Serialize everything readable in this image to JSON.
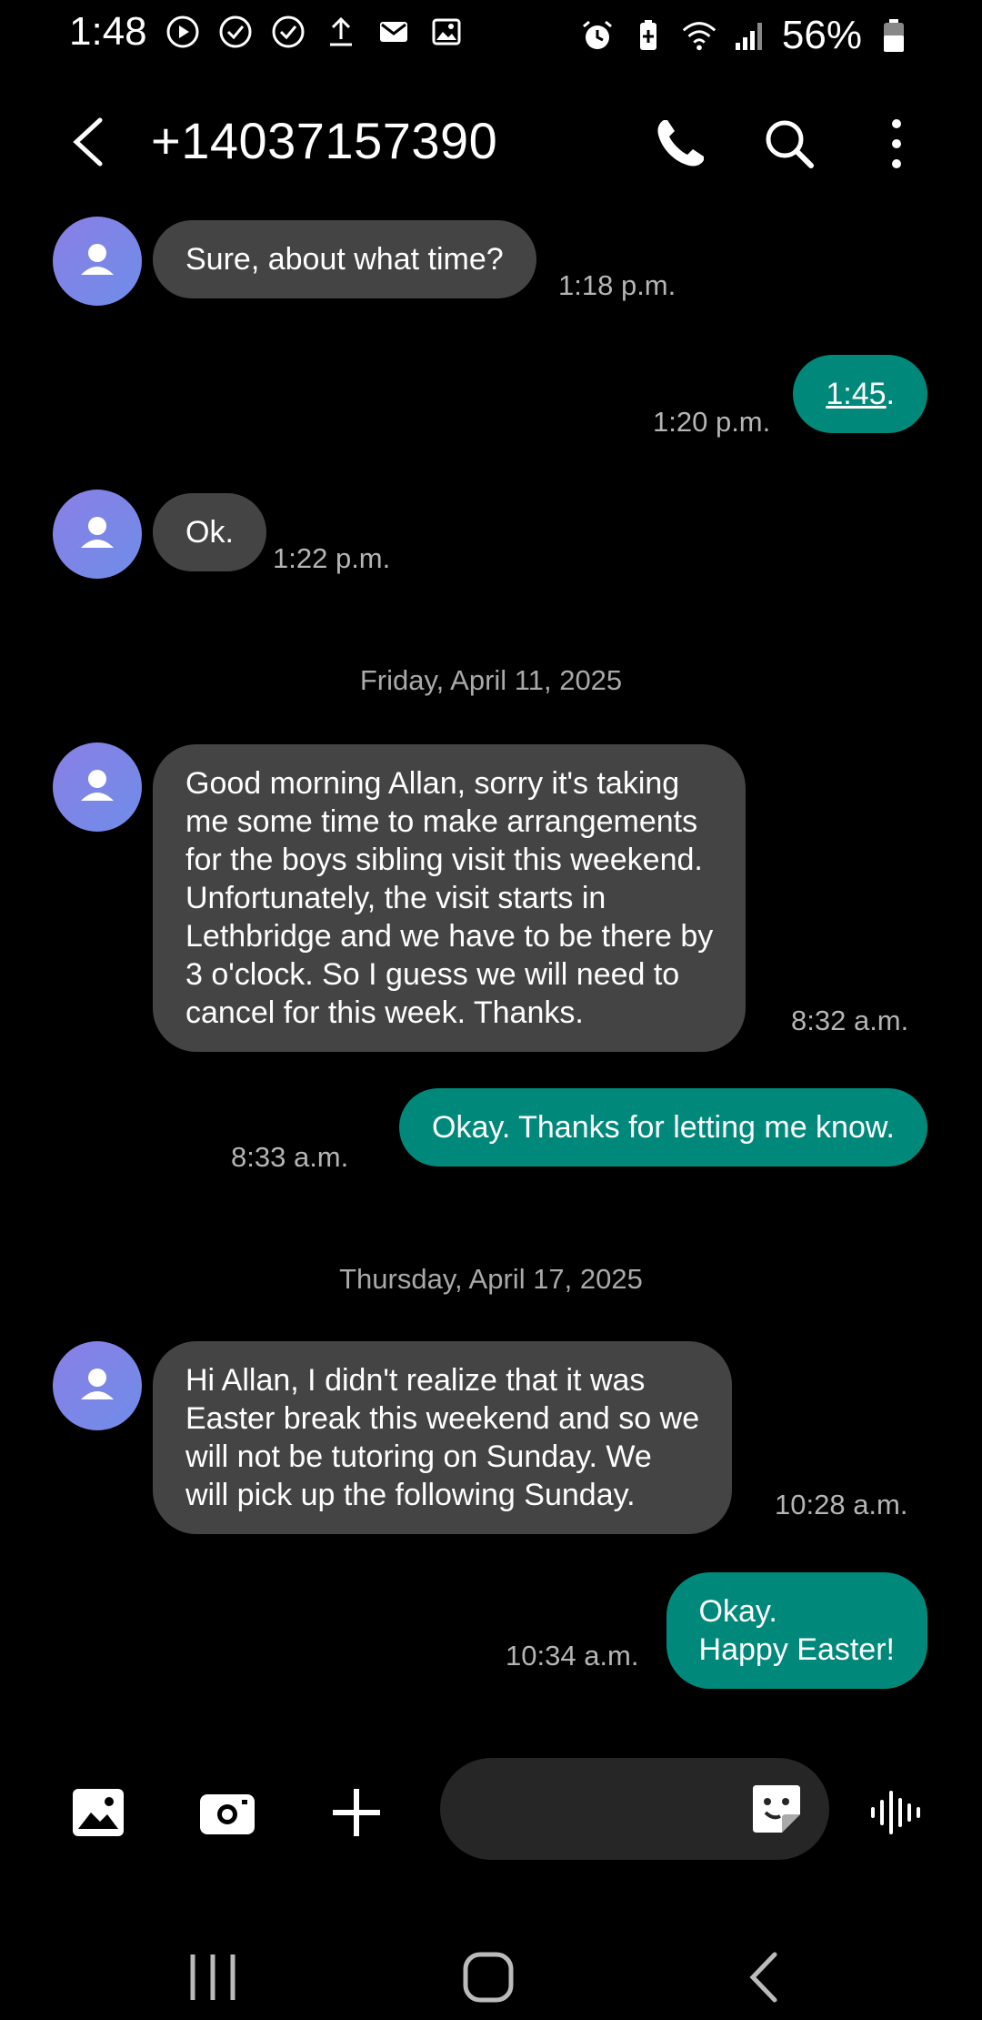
{
  "status_bar": {
    "time": "1:48",
    "battery_percent": "56%",
    "left_icons": [
      "play-icon",
      "check-circle-icon",
      "check-circle-icon",
      "upload-icon",
      "mail-icon",
      "image-icon"
    ],
    "right_icons": [
      "alarm-icon",
      "battery-saver-icon",
      "wifi-icon",
      "signal-icon",
      "battery-icon"
    ]
  },
  "header": {
    "contact": "+14037157390",
    "actions": [
      "call-icon",
      "search-icon",
      "more-icon"
    ]
  },
  "messages": [
    {
      "dir": "in",
      "text": "Sure, about what time?",
      "time": "1:18 p.m."
    },
    {
      "dir": "out",
      "text_link": "1:45",
      "text_suffix": ".",
      "time": "1:20 p.m."
    },
    {
      "dir": "in",
      "text": "Ok.",
      "time": "1:22 p.m."
    },
    {
      "type": "date",
      "text": "Friday, April 11, 2025"
    },
    {
      "dir": "in",
      "lines": [
        "Good morning Allan, sorry it's taking",
        "me some time to make arrangements",
        "for the boys sibling visit this weekend.",
        "Unfortunately, the visit starts in",
        "Lethbridge and we have to be there by",
        "3 o'clock. So I guess we will need to",
        "cancel for this week. Thanks."
      ],
      "time": "8:32 a.m."
    },
    {
      "dir": "out",
      "text": "Okay. Thanks for letting me know.",
      "time": "8:33 a.m."
    },
    {
      "type": "date",
      "text": "Thursday, April 17, 2025"
    },
    {
      "dir": "in",
      "lines": [
        "Hi Allan, I didn't realize that it was",
        "Easter break this weekend and so we",
        "will not be tutoring on Sunday. We",
        "will pick up the following Sunday."
      ],
      "time": "10:28 a.m."
    },
    {
      "dir": "out",
      "lines": [
        "Okay.",
        "Happy Easter!"
      ],
      "time": "10:34 a.m."
    }
  ],
  "composer": {
    "buttons": [
      "gallery-icon",
      "camera-icon",
      "add-icon"
    ],
    "input_value": "",
    "sticker": "sticker-icon",
    "voice": "voice-icon"
  },
  "nav": [
    "recents-icon",
    "home-icon",
    "back-icon"
  ],
  "colors": {
    "incoming_bubble": "#444444",
    "outgoing_bubble": "#00897b",
    "avatar": "#7b86e8",
    "background": "#000000"
  }
}
